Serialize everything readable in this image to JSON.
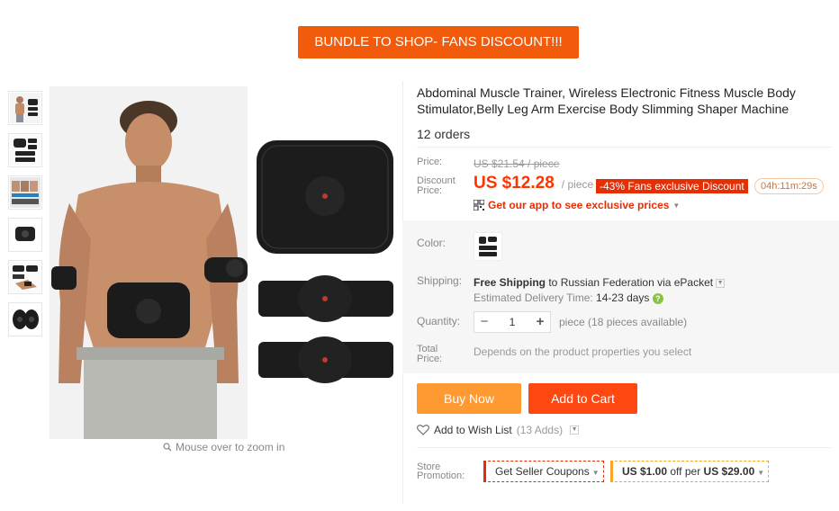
{
  "banner": {
    "text": "BUNDLE TO SHOP- FANS DISCOUNT!!!"
  },
  "gallery": {
    "thumb_count": 6,
    "zoom_hint": "Mouse over to zoom in"
  },
  "product": {
    "title": "Abdominal Muscle Trainer, Wireless Electronic Fitness Muscle Body Stimulator,Belly Leg Arm Exercise Body Slimming Shaper Machine",
    "orders": "12 orders"
  },
  "price": {
    "price_label": "Price:",
    "original": "US $21.54 / piece",
    "discount_label": "Discount Price:",
    "discount_value": "US $12.28",
    "per_piece": "/ piece",
    "badge": "-43% Fans exclusive Discount",
    "countdown": "04h:11m:29s",
    "app_link": "Get our app to see exclusive prices"
  },
  "options": {
    "color_label": "Color:",
    "shipping_label": "Shipping:",
    "shipping_free": "Free Shipping",
    "shipping_rest": " to Russian Federation via ePacket",
    "estimated_label": "Estimated Delivery Time: ",
    "estimated_value": "14-23 days",
    "quantity_label": "Quantity:",
    "quantity_value": "1",
    "quantity_avail": "piece (18 pieces available)",
    "total_label": "Total Price:",
    "total_value": "Depends on the product properties you select"
  },
  "actions": {
    "buy_now": "Buy Now",
    "add_to_cart": "Add to Cart",
    "wishlist": "Add to Wish List",
    "wishlist_adds": "(13 Adds)"
  },
  "promotion": {
    "label": "Store Promotion:",
    "seller_coupons": "Get Seller Coupons",
    "store_amount": "US $1.00",
    "store_mid": " off per ",
    "store_min": "US $29.00"
  },
  "colors": {
    "banner": "#f35b0c",
    "discount_price": "#ff3300",
    "badge": "#e62e04",
    "buy_now": "#ff9a32",
    "add_to_cart": "#ff4712"
  }
}
